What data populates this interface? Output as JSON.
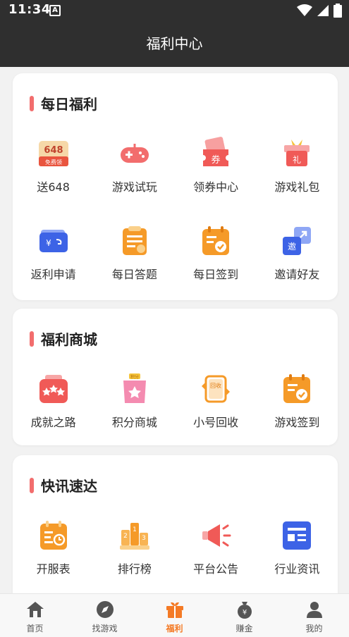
{
  "status_bar": {
    "time": "11:34",
    "app_badge": "A"
  },
  "header": {
    "title": "福利中心"
  },
  "sections": [
    {
      "title": "每日福利",
      "items": [
        {
          "label": "送648",
          "icon": "coupon-648-icon",
          "icon_badge_top": "648",
          "icon_badge_bottom": "免费领"
        },
        {
          "label": "游戏试玩",
          "icon": "gamepad-icon"
        },
        {
          "label": "领券中心",
          "icon": "ticket-icon",
          "icon_text": "券"
        },
        {
          "label": "游戏礼包",
          "icon": "gift-box-icon",
          "icon_text": "礼"
        },
        {
          "label": "返利申请",
          "icon": "wallet-rebate-icon",
          "icon_text": "¥"
        },
        {
          "label": "每日答题",
          "icon": "quiz-clipboard-icon"
        },
        {
          "label": "每日签到",
          "icon": "calendar-check-icon"
        },
        {
          "label": "邀请好友",
          "icon": "invite-icon",
          "icon_text": "邀"
        }
      ]
    },
    {
      "title": "福利商城",
      "items": [
        {
          "label": "成就之路",
          "icon": "achievement-stars-icon"
        },
        {
          "label": "积分商城",
          "icon": "points-bag-icon",
          "icon_text": "积分"
        },
        {
          "label": "小号回收",
          "icon": "recycle-icon",
          "icon_text": "回收"
        },
        {
          "label": "游戏签到",
          "icon": "game-checkin-icon"
        }
      ]
    },
    {
      "title": "快讯速达",
      "items": [
        {
          "label": "开服表",
          "icon": "server-schedule-icon"
        },
        {
          "label": "排行榜",
          "icon": "ranking-podium-icon"
        },
        {
          "label": "平台公告",
          "icon": "megaphone-icon"
        },
        {
          "label": "行业资讯",
          "icon": "news-icon"
        }
      ]
    }
  ],
  "tabs": [
    {
      "label": "首页",
      "icon": "home-icon",
      "active": false
    },
    {
      "label": "找游戏",
      "icon": "compass-icon",
      "active": false
    },
    {
      "label": "福利",
      "icon": "gift-icon",
      "active": true
    },
    {
      "label": "赚金",
      "icon": "money-bag-icon",
      "active": false
    },
    {
      "label": "我的",
      "icon": "user-icon",
      "active": false
    }
  ],
  "colors": {
    "header_bg": "#2f2f2f",
    "accent_orange": "#f47a25",
    "section_bar": "#f26d6d",
    "page_bg": "#f2f2f2"
  }
}
